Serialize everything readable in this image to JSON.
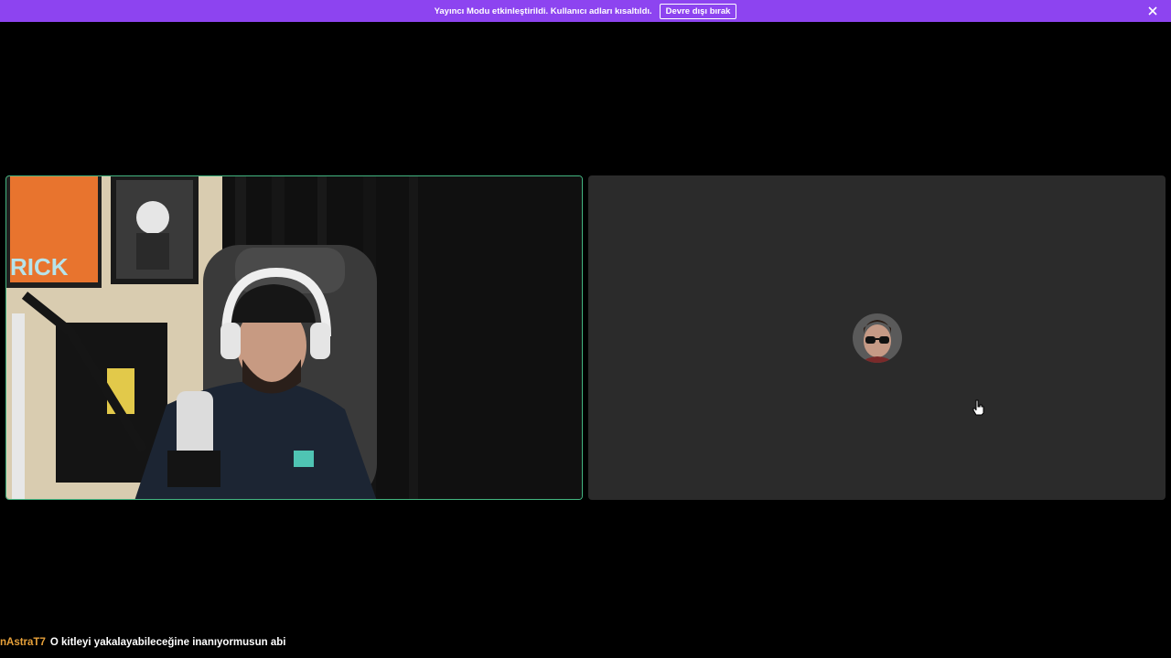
{
  "notice": {
    "text": "Yayıncı Modu etkinleştirildi. Kullanıcı adları kısaltıldı.",
    "button_label": "Devre dışı bırak",
    "close_icon": "close-icon",
    "background": "#8d44f0"
  },
  "tiles": {
    "camera": {
      "speaking_border_color": "#43b581"
    },
    "avatar": {
      "background": "#2b2b2b",
      "avatar_icon": "user-avatar"
    }
  },
  "chat": {
    "username": "nAstraT7",
    "message": "O kitleyi yakalayabileceğine inanıyormusun abi",
    "username_color": "#e7a13a"
  }
}
